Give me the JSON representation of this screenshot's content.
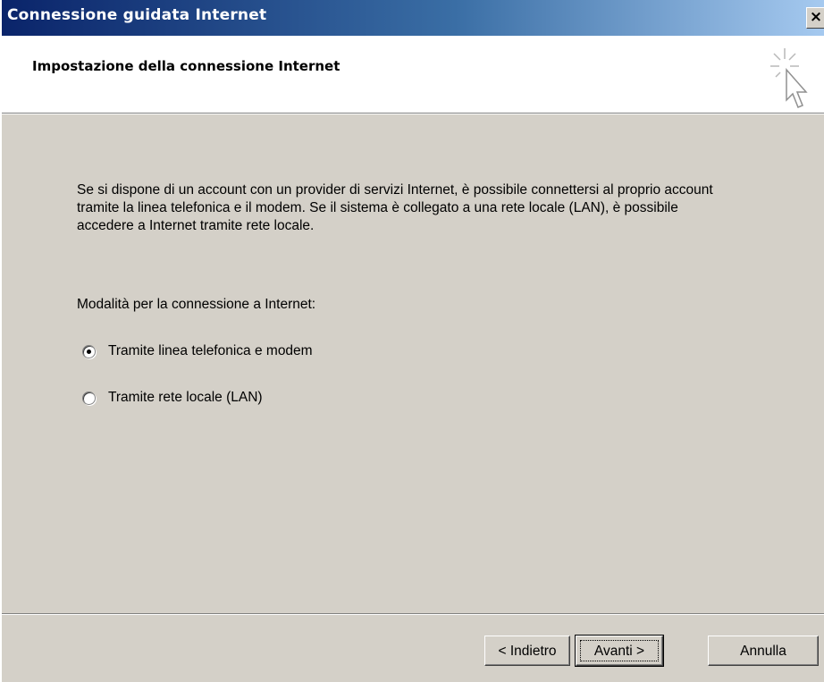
{
  "window": {
    "title": "Connessione guidata Internet",
    "close_glyph": "×"
  },
  "header": {
    "title": "Impostazione della connessione Internet",
    "icon": "wizard-cursor-icon"
  },
  "main": {
    "description": "Se si dispone di un account con un provider di servizi Internet, è possibile connettersi al proprio account tramite la linea telefonica e il modem. Se il sistema è collegato a una rete locale (LAN), è possibile accedere a Internet tramite rete locale.",
    "prompt": "Modalità per la connessione a Internet:",
    "options": [
      {
        "label": "Tramite linea telefonica e modem",
        "checked": true
      },
      {
        "label": "Tramite rete locale (LAN)",
        "checked": false
      }
    ]
  },
  "buttons": {
    "back_label": "< Indietro",
    "next_label": "Avanti >",
    "cancel_label": "Annulla"
  },
  "colors": {
    "titlebar_start": "#0a246a",
    "titlebar_end": "#a6caf0",
    "dialog_bg": "#d4d0c8",
    "header_bg": "#ffffff"
  }
}
